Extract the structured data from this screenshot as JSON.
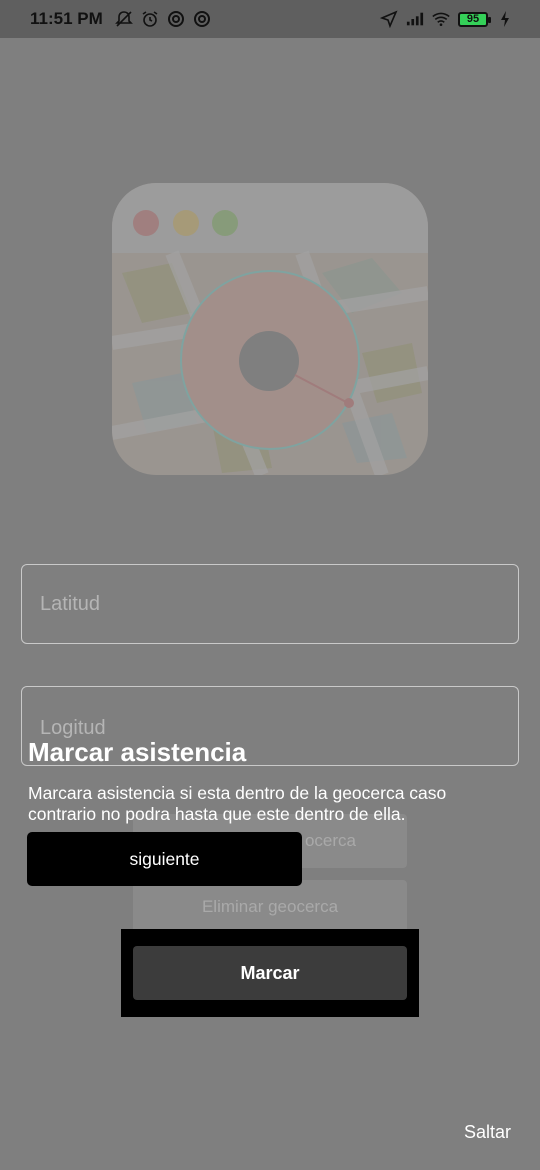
{
  "status_bar": {
    "time": "11:51 PM",
    "battery": "95",
    "left_icons": [
      "bell-off-icon",
      "alarm-icon",
      "do-not-disturb-icon",
      "do-not-disturb-icon"
    ],
    "right_icons": [
      "location-arrow-icon",
      "signal-icon",
      "wifi-icon",
      "battery-icon",
      "charging-icon"
    ]
  },
  "form": {
    "latitud_placeholder": "Latitud",
    "longitud_placeholder": "Logitud"
  },
  "buttons": {
    "geocerca_label": "ocerca",
    "eliminar_label": "Eliminar geocerca",
    "marcar_label": "Marcar"
  },
  "tutorial": {
    "title": "Marcar asistencia",
    "description": "Marcara asistencia si esta dentro de la geocerca caso contrario no podra hasta que este dentro de ella.",
    "next_label": "siguiente",
    "skip_label": "Saltar"
  },
  "colors": {
    "overlay": "#7f7f7f",
    "statusbar": "#5f5f5f",
    "highlight": "#000000",
    "button": "#3c3c3c"
  }
}
